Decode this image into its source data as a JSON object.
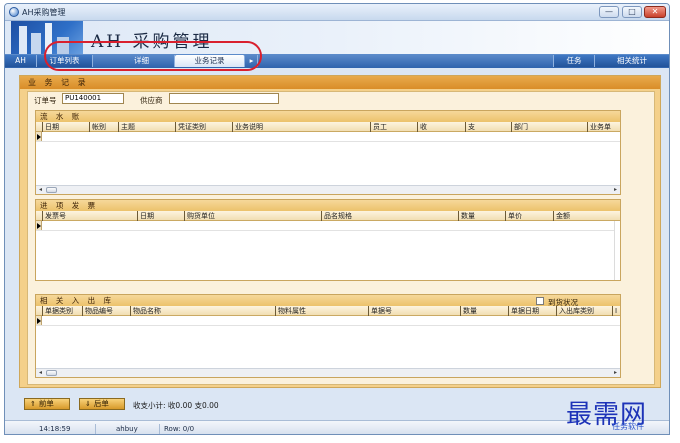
{
  "window": {
    "title": "AH采购管理",
    "app_title": "AH 采购管理",
    "minimize_label": "—",
    "maximize_label": "□",
    "close_label": "✕"
  },
  "tabs": {
    "home": "AH",
    "items": [
      {
        "label": "订单列表"
      },
      {
        "label": "详细"
      },
      {
        "label": "业务记录"
      }
    ],
    "more": "▸",
    "right": [
      {
        "label": "任务"
      },
      {
        "label": "相关统计"
      }
    ]
  },
  "colors": {
    "highlight_ring": "#d9202e",
    "section_orange": "#d98d28",
    "panel_bg": "#f4d08a",
    "watermark": "#1d33b8"
  },
  "main": {
    "section_title": "业 务 记 录",
    "order_no_label": "订单号",
    "order_no_value": "PU140001",
    "supplier_label": "供应商",
    "supplier_value": ""
  },
  "ledger": {
    "title": "流 水 账",
    "columns": [
      "日期",
      "帐别",
      "主题",
      "凭证类别",
      "业务说明",
      "员工",
      "收",
      "支",
      "部门",
      "业务单"
    ]
  },
  "invoices": {
    "title": "进 项 发 票",
    "columns": [
      "发票号",
      "日期",
      "购货单位",
      "品名规格",
      "数量",
      "单价",
      "金额"
    ]
  },
  "stock": {
    "title": "相 关 入 出 库",
    "arrival_label": "到货状况",
    "columns": [
      "单据类别",
      "物品编号",
      "物品名称",
      "物料属性",
      "单据号",
      "数量",
      "单据日期",
      "入出库类别",
      "I"
    ]
  },
  "bottom": {
    "prev_icon": "⇑",
    "prev_label": "前单",
    "next_icon": "⇓",
    "next_label": "后单",
    "summary": "收支小计:  收0.00  支0.00"
  },
  "status": {
    "time": "14:18:59",
    "user": "ahbuy",
    "row": "Row: 0/0"
  },
  "watermark": {
    "text": "最需网",
    "sub": "任务软件"
  }
}
